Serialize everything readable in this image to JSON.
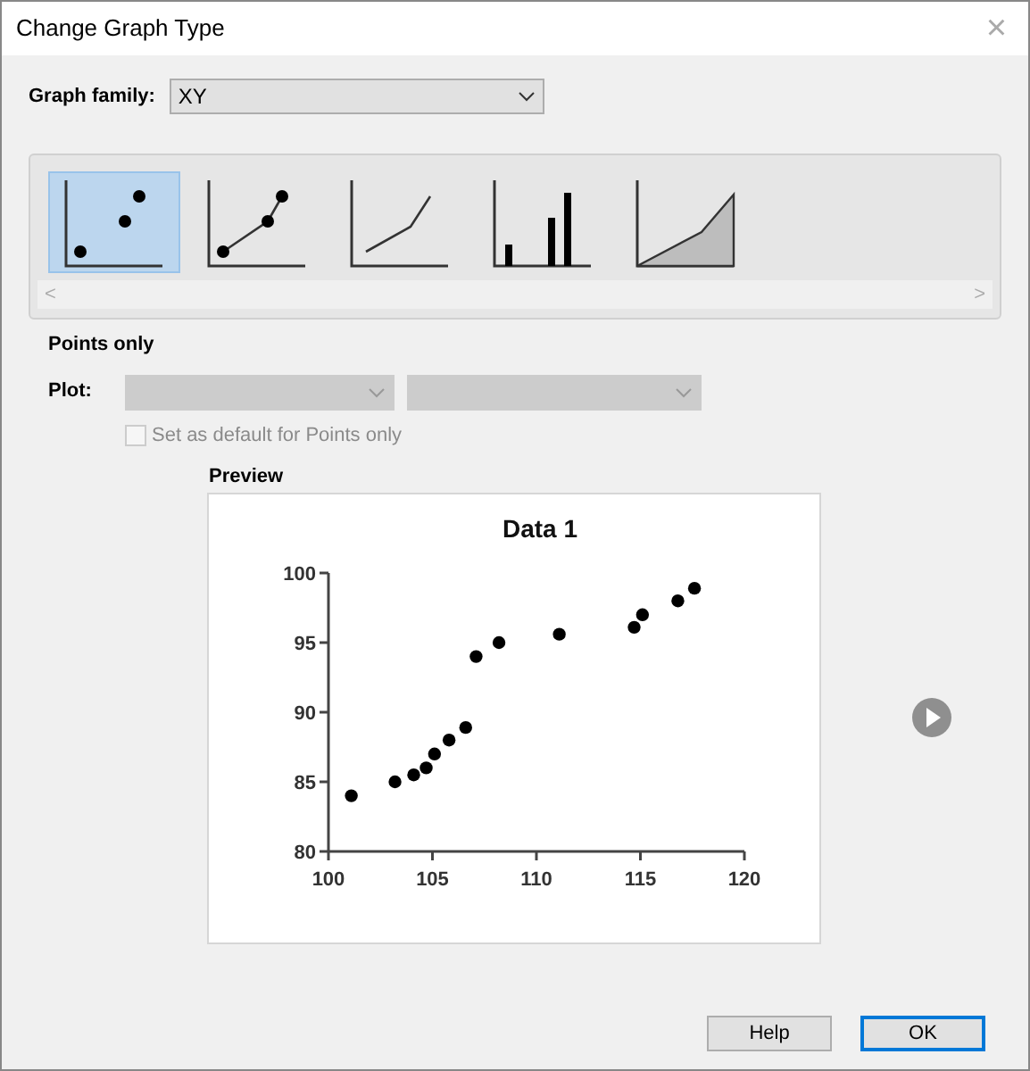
{
  "window": {
    "title": "Change Graph Type",
    "close": "×"
  },
  "graph_family": {
    "label": "Graph family:",
    "value": "XY"
  },
  "gallery": [
    {
      "kind": "scatter",
      "selected": true
    },
    {
      "kind": "line_points",
      "selected": false
    },
    {
      "kind": "line",
      "selected": false
    },
    {
      "kind": "bar",
      "selected": false
    },
    {
      "kind": "area",
      "selected": false
    }
  ],
  "scroll": {
    "left": "<",
    "right": ">"
  },
  "type_name": "Points only",
  "plot": {
    "label": "Plot:",
    "disabled": true
  },
  "default_checkbox": {
    "label": "Set as default for Points only",
    "checked": false,
    "disabled": true
  },
  "preview": {
    "label": "Preview",
    "chart_data": {
      "type": "scatter",
      "title": "Data 1",
      "xlim": [
        100,
        120
      ],
      "ylim": [
        80,
        100
      ],
      "xticks": [
        100,
        105,
        110,
        115,
        120
      ],
      "yticks": [
        80,
        85,
        90,
        95,
        100
      ],
      "x": [
        101.1,
        103.2,
        104.1,
        104.7,
        105.1,
        105.8,
        106.6,
        107.1,
        108.2,
        111.1,
        114.7,
        115.1,
        116.8,
        117.6
      ],
      "series": [
        {
          "color": "#000000",
          "values": [
            84.0,
            85.0,
            85.5,
            86.0,
            87.0,
            88.0,
            88.9,
            94.0,
            95.0,
            95.6,
            96.1,
            97.0,
            98.0,
            98.9
          ]
        }
      ]
    }
  },
  "buttons": [
    {
      "label": "Help",
      "default": false
    },
    {
      "label": "OK",
      "default": true
    }
  ]
}
